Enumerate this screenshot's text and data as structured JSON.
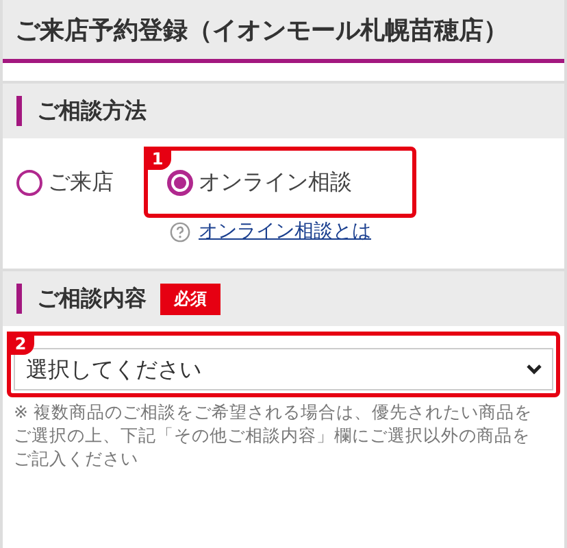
{
  "page_title": "ご来店予約登録（イオンモール札幌苗穂店）",
  "sections": [
    {
      "heading": "ご相談方法",
      "kind": "radios",
      "options": [
        {
          "label": "ご来店",
          "selected": false
        },
        {
          "label": "オンライン相談",
          "selected": true,
          "annotation": "1"
        }
      ],
      "help_link": "オンライン相談とは"
    },
    {
      "heading": "ご相談内容",
      "required_badge": "必須",
      "kind": "select",
      "select": {
        "value": "選択してください",
        "annotation": "2"
      },
      "note": "※ 複数商品のご相談をご希望される場合は、優先されたい商品をご選択の上、下記「その他ご相談内容」欄にご選択以外の商品をご記入ください"
    }
  ]
}
